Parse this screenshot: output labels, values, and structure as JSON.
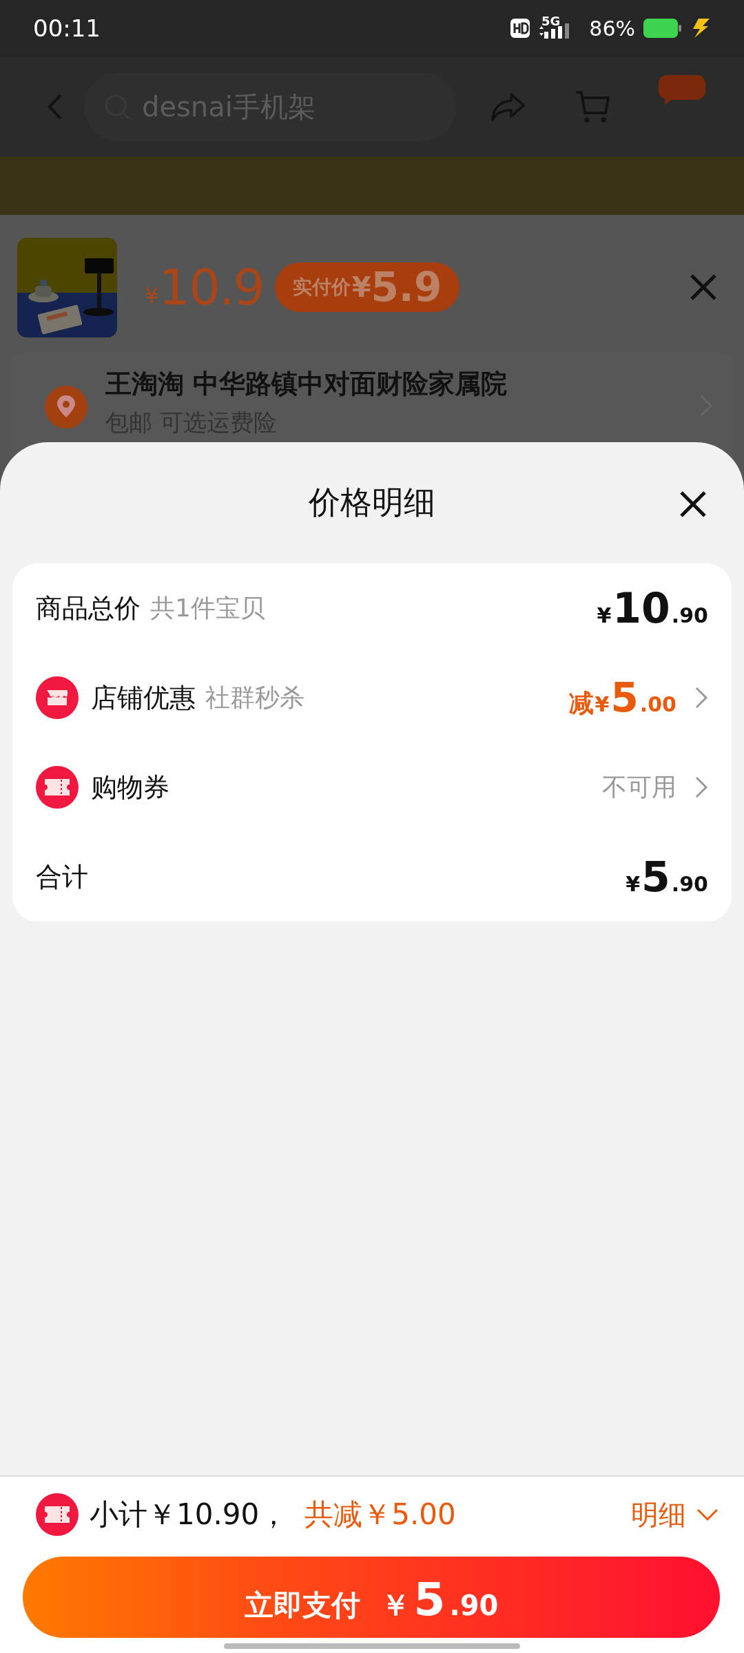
{
  "status_bar": {
    "time": "00:11",
    "network": "5G",
    "battery": "86%"
  },
  "nav": {
    "search_placeholder": "desnai手机架"
  },
  "product": {
    "currency": "¥",
    "price": "10.9",
    "badge": {
      "label": "实付价",
      "currency": "¥",
      "amount": "5.9"
    }
  },
  "address": {
    "name_line": "王淘淘 中华路镇中对面财险家属院",
    "subtitle": "包邮 可选运费险"
  },
  "sheet": {
    "title": "价格明细",
    "rows": [
      {
        "kind": "plain",
        "label": "商品总价",
        "note": "共1件宝贝",
        "currency": "¥",
        "integer": "10",
        "decimal": ".90"
      },
      {
        "kind": "shop",
        "label": "店铺优惠",
        "note": "社群秒杀",
        "prefix": "减",
        "currency": "¥",
        "integer": "5",
        "decimal": ".00"
      },
      {
        "kind": "coupon",
        "label": "购物券",
        "status": "不可用"
      },
      {
        "kind": "plain",
        "label": "合计",
        "currency": "¥",
        "integer": "5",
        "decimal": ".90"
      }
    ]
  },
  "footer": {
    "subtotal": "小计￥10.90，",
    "discount": "共减￥5.00",
    "details": "明细",
    "pay_button": {
      "label": "立即支付",
      "currency": "￥",
      "integer": "5",
      "decimal": ".90"
    }
  }
}
